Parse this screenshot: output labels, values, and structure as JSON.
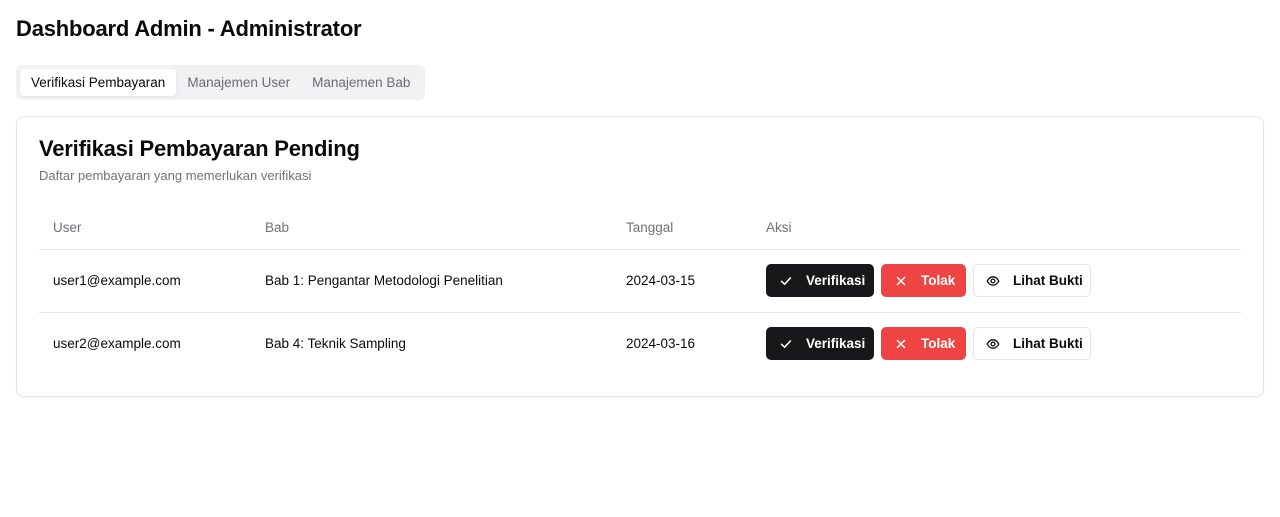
{
  "header": {
    "title": "Dashboard Admin - Administrator"
  },
  "tabs": [
    {
      "label": "Verifikasi Pembayaran",
      "active": true
    },
    {
      "label": "Manajemen User",
      "active": false
    },
    {
      "label": "Manajemen Bab",
      "active": false
    }
  ],
  "card": {
    "title": "Verifikasi Pembayaran Pending",
    "description": "Daftar pembayaran yang memerlukan verifikasi"
  },
  "table": {
    "columns": [
      "User",
      "Bab",
      "Tanggal",
      "Aksi"
    ],
    "rows": [
      {
        "user": "user1@example.com",
        "bab": "Bab 1: Pengantar Metodologi Penelitian",
        "tanggal": "2024-03-15"
      },
      {
        "user": "user2@example.com",
        "bab": "Bab 4: Teknik Sampling",
        "tanggal": "2024-03-16"
      }
    ]
  },
  "actions": {
    "verify_label": "Verifikasi",
    "verify_icon": "check-icon",
    "reject_label": "Tolak",
    "reject_icon": "x-icon",
    "proof_label": "Lihat Bukti",
    "proof_icon": "eye-icon"
  },
  "colors": {
    "verify_bg": "#18181b",
    "reject_bg": "#ef4444",
    "tab_bg": "#f1f1f3",
    "border": "#e4e4e7",
    "muted_text": "#71717a"
  }
}
